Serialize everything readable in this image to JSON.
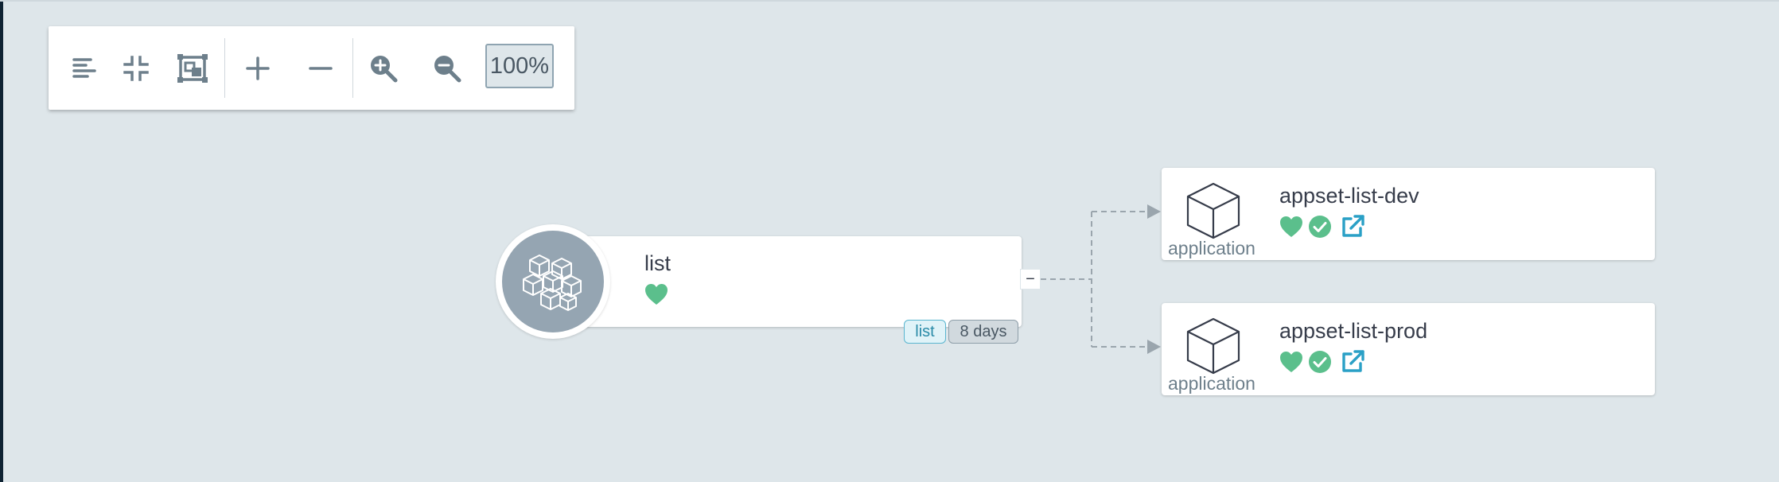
{
  "toolbar": {
    "zoom_level": "100%",
    "buttons": [
      {
        "name": "align-left-icon"
      },
      {
        "name": "compress-icon"
      },
      {
        "name": "fit-screen-icon"
      },
      {
        "name": "plus-icon"
      },
      {
        "name": "minus-icon"
      },
      {
        "name": "zoom-in-icon"
      },
      {
        "name": "zoom-out-icon"
      }
    ]
  },
  "root_node": {
    "title": "list",
    "health_icon": "heart-icon",
    "tags": [
      "list",
      "8 days"
    ],
    "collapse_label": "−"
  },
  "children": [
    {
      "name": "appset-list-dev",
      "kind": "application"
    },
    {
      "name": "appset-list-prod",
      "kind": "application"
    }
  ],
  "colors": {
    "background": "#dee6ea",
    "healthy": "#5bbf8c",
    "synced": "#5bbf8c",
    "link": "#2aa0c6",
    "node_circle": "#95a5b2",
    "edge": "#9aa5ad"
  }
}
